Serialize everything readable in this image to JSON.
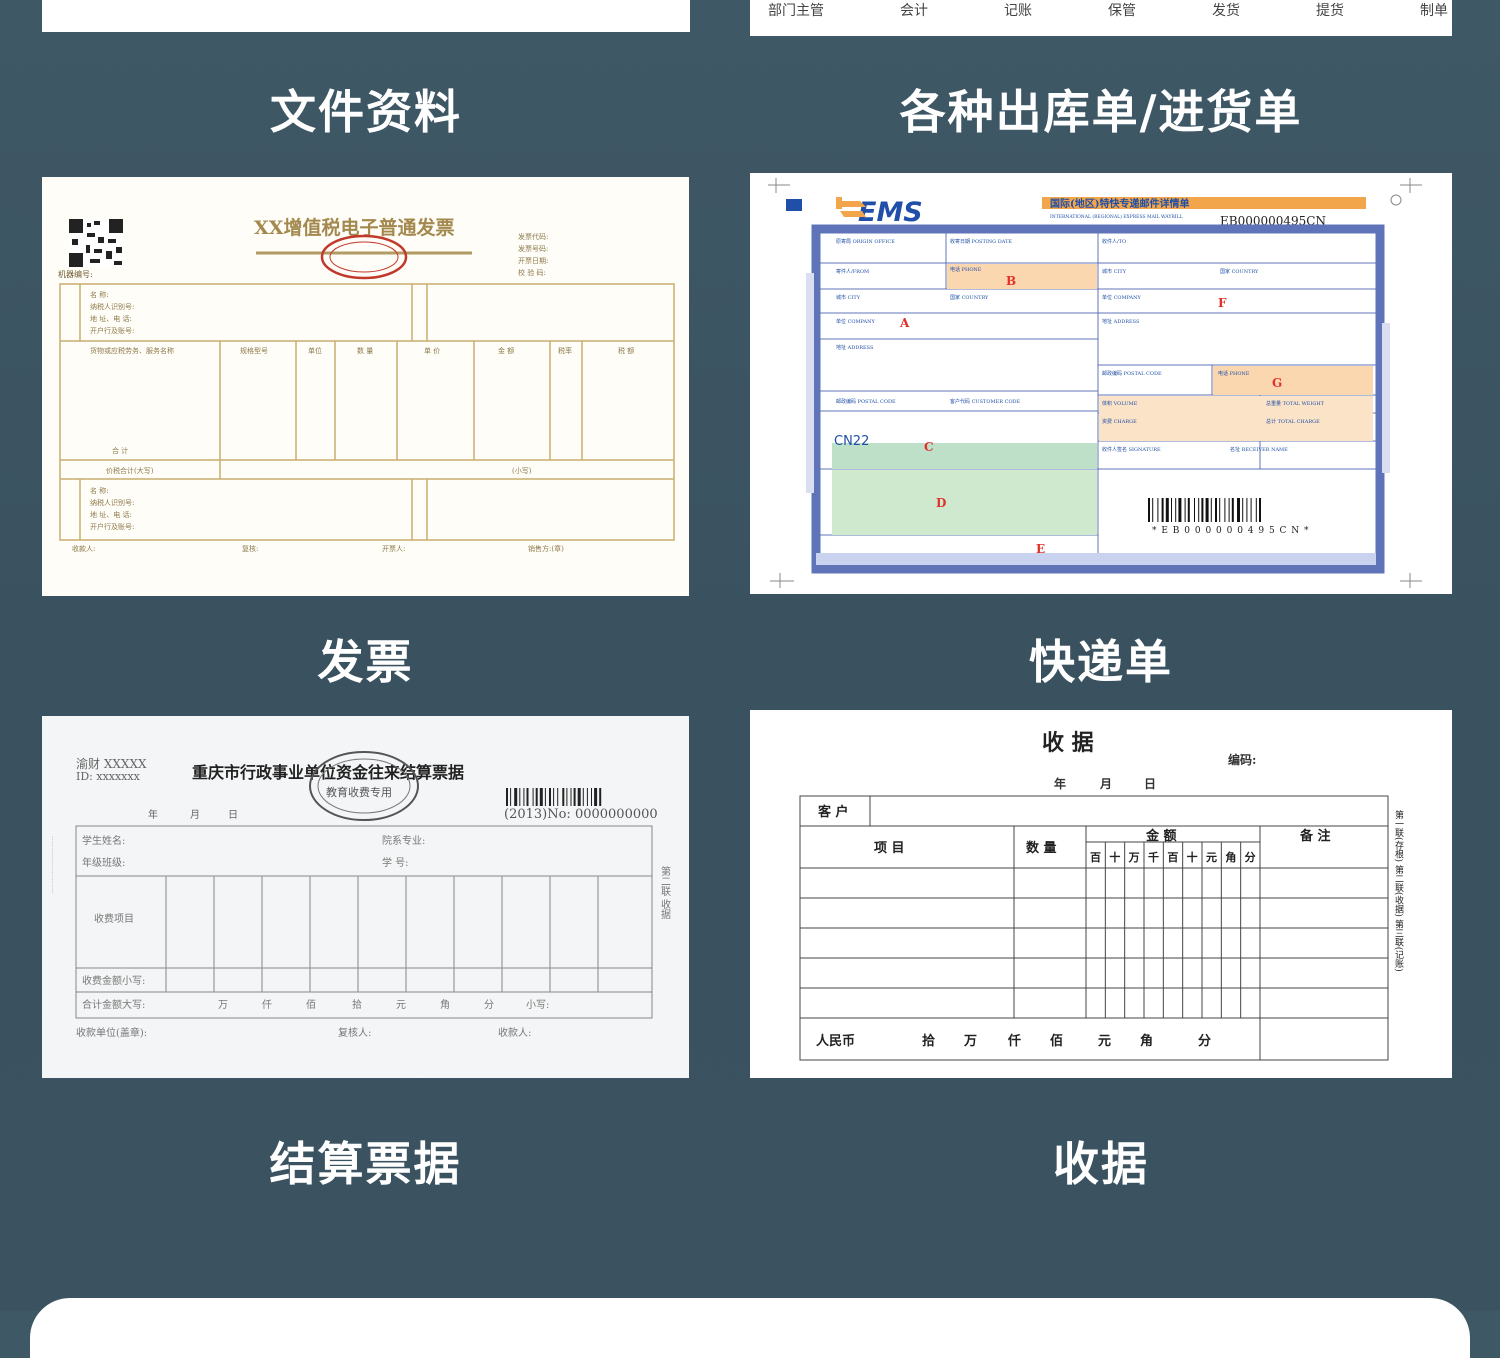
{
  "captions": {
    "documents": "文件资料",
    "delivery": "各种出库单/进货单",
    "invoice": "发票",
    "express": "快递单",
    "settlement": "结算票据",
    "receipt": "收据"
  },
  "delivery_form": {
    "signatures": [
      "部门主管",
      "会计",
      "记账",
      "保管",
      "发货",
      "提货",
      "制单"
    ]
  },
  "invoice_form": {
    "title": "XX增值税电子普通发票"
  },
  "express_form": {
    "brand": "EMS",
    "header_cn": "国际(地区)特快专递邮件详情单",
    "header_en": "INTERNATIONAL (REGIONAL) EXPRESS MAIL WAYBILL",
    "tracking": "EB000000495CN",
    "barcode_text": "* E B 0 0 0 0 0 0 4 9 5 C N *",
    "cn22": "CN22",
    "markers": [
      "A",
      "B",
      "C",
      "D",
      "E",
      "F",
      "G"
    ],
    "colors": {
      "brand": "#1f4fa8",
      "accent": "#f2a54a",
      "frame": "#5f74b8",
      "green": "#cfe9cf"
    }
  },
  "settlement_form": {
    "corner1": "渝财 XXXXX",
    "corner2": "ID: xxxxxxx",
    "title": "重庆市行政事业单位资金往来结算票据",
    "stamp": "教育收费专用",
    "number": "(2013)No: 0000000000",
    "date_row": [
      "年",
      "月",
      "日"
    ],
    "labels": {
      "student": "学生姓名:",
      "college": "院系专业:",
      "grade": "年级班级:",
      "student_no": "学    号:",
      "item": "收费项目",
      "amount_small": "收费金额小写:",
      "amount_big": "合计金额大写:",
      "units": [
        "万",
        "仟",
        "佰",
        "拾",
        "元",
        "角",
        "分",
        "小写:"
      ],
      "payee_unit": "收款单位(盖章):",
      "reviewer": "复核人:",
      "payee": "收款人:"
    },
    "side": "第二联 收据"
  },
  "receipt_form": {
    "title": "收    据",
    "code": "编码:",
    "date": [
      "年",
      "月",
      "日"
    ],
    "customer": "客 户",
    "item": "项    目",
    "qty": "数  量",
    "amount": "金    额",
    "remark": "备  注",
    "digits": [
      "百",
      "十",
      "万",
      "千",
      "百",
      "十",
      "元",
      "角",
      "分"
    ],
    "rmb": "人民币",
    "rmb_units": [
      "拾",
      "万",
      "仟",
      "佰",
      "元",
      "角",
      "分"
    ],
    "side": "第一联(存根) 第二联(收据) 第三联(记账)"
  }
}
